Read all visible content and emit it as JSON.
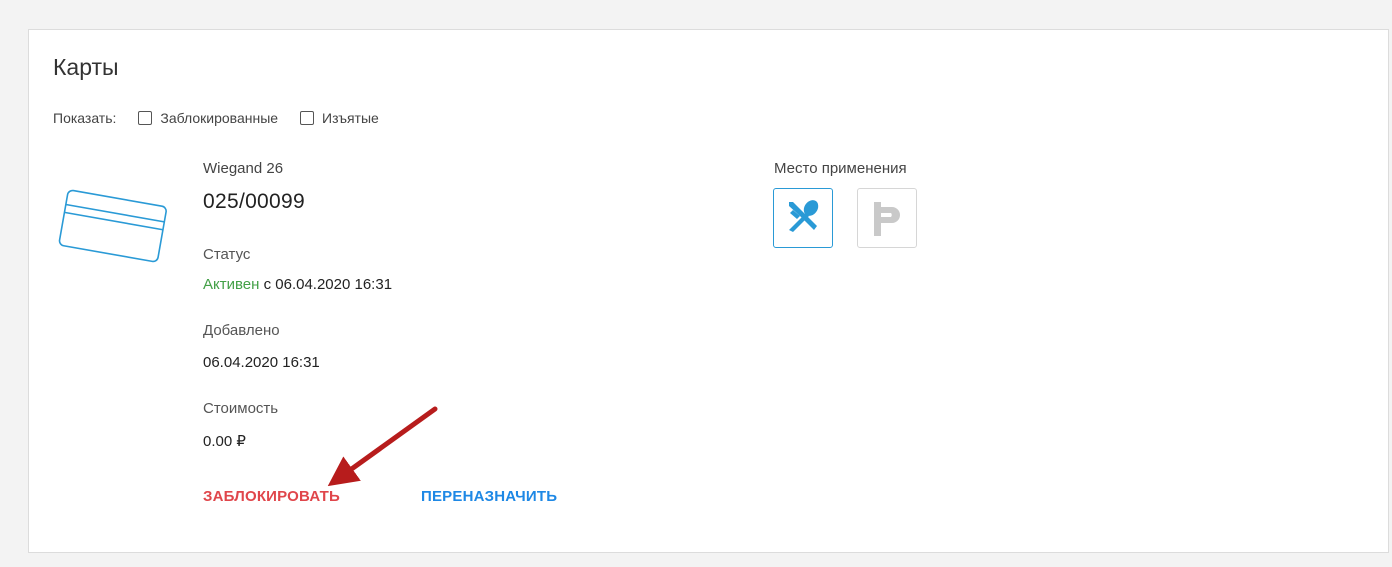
{
  "panel": {
    "title": "Карты"
  },
  "filters": {
    "label": "Показать:",
    "options": [
      {
        "label": "Заблокированные",
        "checked": false
      },
      {
        "label": "Изъятые",
        "checked": false
      }
    ]
  },
  "card": {
    "type": "Wiegand 26",
    "number": "025/00099",
    "status_label": "Статус",
    "status_value": "Активен",
    "status_since": "с 06.04.2020 16:31",
    "added_label": "Добавлено",
    "added_value": "06.04.2020 16:31",
    "cost_label": "Стоимость",
    "cost_value": "0.00 ₽"
  },
  "actions": {
    "block_label": "ЗАБЛОКИРОВАТЬ",
    "reassign_label": "ПЕРЕНАЗНАЧИТЬ"
  },
  "place": {
    "label": "Место применения",
    "items": [
      {
        "icon": "fork-spoon-icon",
        "active": true
      },
      {
        "icon": "parking-icon",
        "active": false
      }
    ]
  },
  "colors": {
    "accent": "#2a9ad6",
    "danger": "#e0464b",
    "link": "#1e88e5",
    "success": "#43a047",
    "annotation_arrow": "#b71c1c"
  }
}
